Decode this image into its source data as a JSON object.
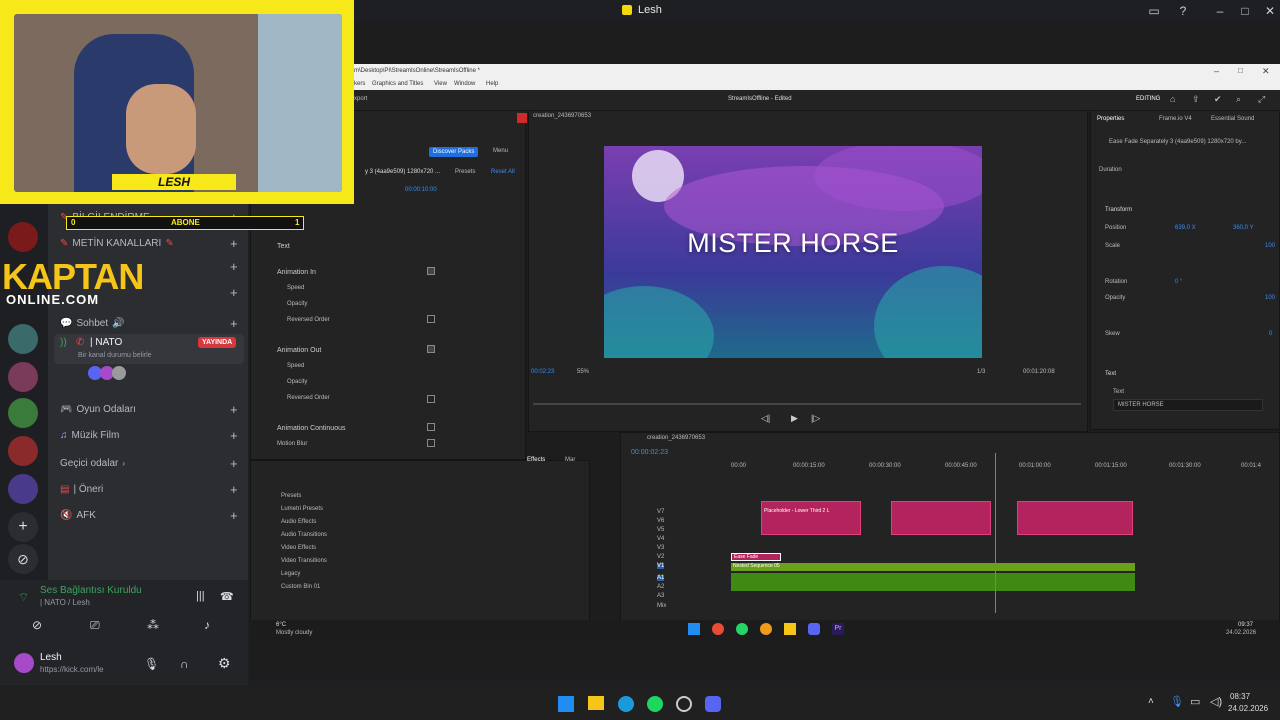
{
  "window": {
    "title": "Lesh"
  },
  "overlay": {
    "streamer_name": "LESH",
    "sub_bar": {
      "left": "0",
      "label": "ABONE",
      "right": "1"
    },
    "logo_top": "KAPTAN",
    "logo_bottom": "ONLINE.COM"
  },
  "discord": {
    "channels": [
      {
        "label": "BİLGİLENDİRME"
      },
      {
        "label": "METİN KANALLARI"
      },
      {
        "label": "Sohbet"
      }
    ],
    "live_channel": {
      "name": "| NATO",
      "badge": "YAYINDA",
      "desc": "Bir kanal durumu belirle"
    },
    "channels2": [
      {
        "label": "Oyun Odaları"
      },
      {
        "label": "Müzik Film"
      },
      {
        "label": "Geçici odalar"
      },
      {
        "label": "| Öneri"
      },
      {
        "label": "AFK"
      }
    ],
    "voice": {
      "status": "Ses Bağlantısı Kuruldu",
      "channel": "| NATO / Lesh"
    },
    "user": {
      "name": "Lesh",
      "status": "https://kick.com/le"
    }
  },
  "premiere": {
    "path": "m\\Desktop\\PI\\StreamIsOnline\\StreamIsOffline *",
    "menu": [
      "kers",
      "Graphics and Titles",
      "View",
      "Window",
      "Help"
    ],
    "export_label": "xport",
    "project_title": "StreamIsOffline - Edited",
    "workspace": "EDITING",
    "sequence_tab": "creation_2436970653",
    "video_text": "MISTER HORSE",
    "timecode_left": "00:02:23",
    "zoom": "55%",
    "quality": "1/3",
    "timecode_right": "00:01:20:08",
    "eg": {
      "discover": "Discover Packs",
      "menu": "Menu",
      "item": "y 3 (4aa9e509) 1280x720 ...",
      "presets": "Presets",
      "reset_all": "Reset All",
      "sections": [
        {
          "label": "Text"
        },
        {
          "label": "Animation In"
        },
        {
          "label": "Speed"
        },
        {
          "label": "Opacity"
        },
        {
          "label": "Reversed Order"
        },
        {
          "label": "Animation Out"
        },
        {
          "label": "Speed"
        },
        {
          "label": "Opacity"
        },
        {
          "label": "Reversed Order"
        },
        {
          "label": "Animation Continuous"
        },
        {
          "label": "Motion Blur"
        }
      ]
    },
    "props": {
      "tabs": [
        "Properties",
        "Frame.io V4",
        "Essential Sound"
      ],
      "clip": "Ease Fade Separately 3 (4aa9e509) 1280x720 by...",
      "duration": "Duration",
      "transform": "Transform",
      "position": "Position",
      "pos_x": "639,0 X",
      "pos_y": "360,0 Y",
      "scale": "Scale",
      "scale_val": "100",
      "rotation": "Rotation",
      "rotation_val": "0 °",
      "opacity": "Opacity",
      "opacity_val": "100",
      "skew": "Skew",
      "skew_val": "0",
      "text_label": "Text",
      "text_sub": "Text",
      "text_val": "MISTER HORSE"
    },
    "project": {
      "tabs": [
        "Effects",
        "Mar"
      ],
      "items": [
        "Presets",
        "Lumetri Presets",
        "Audio Effects",
        "Audio Transitions",
        "Video Effects",
        "Video Transitions",
        "Legacy",
        "Custom Bin 01"
      ]
    },
    "timeline": {
      "tab": "creation_2436970653",
      "timecode": "00:00:02:23",
      "ruler": [
        "00:00",
        "00:00:15:00",
        "00:00:30:00",
        "00:00:45:00",
        "00:01:00:00",
        "00:01:15:00",
        "00:01:30:00",
        "00:01:4"
      ],
      "tracks": [
        "V7",
        "V6",
        "V5",
        "V4",
        "V3",
        "V2",
        "V1",
        "A1",
        "A2",
        "A3",
        "Mix"
      ],
      "clip_label": "Ease Fade",
      "nested": "Nested Sequence 05",
      "placeholder": "Placeholder - Lower Third 2 L"
    },
    "weather": {
      "temp": "6°C",
      "desc": "Mostly cloudy"
    },
    "inner_clock": {
      "time": "09:37",
      "date": "24.02.2026"
    }
  },
  "taskbar": {
    "lang": "TR",
    "time": "08:37",
    "date": "24.02.2026"
  }
}
